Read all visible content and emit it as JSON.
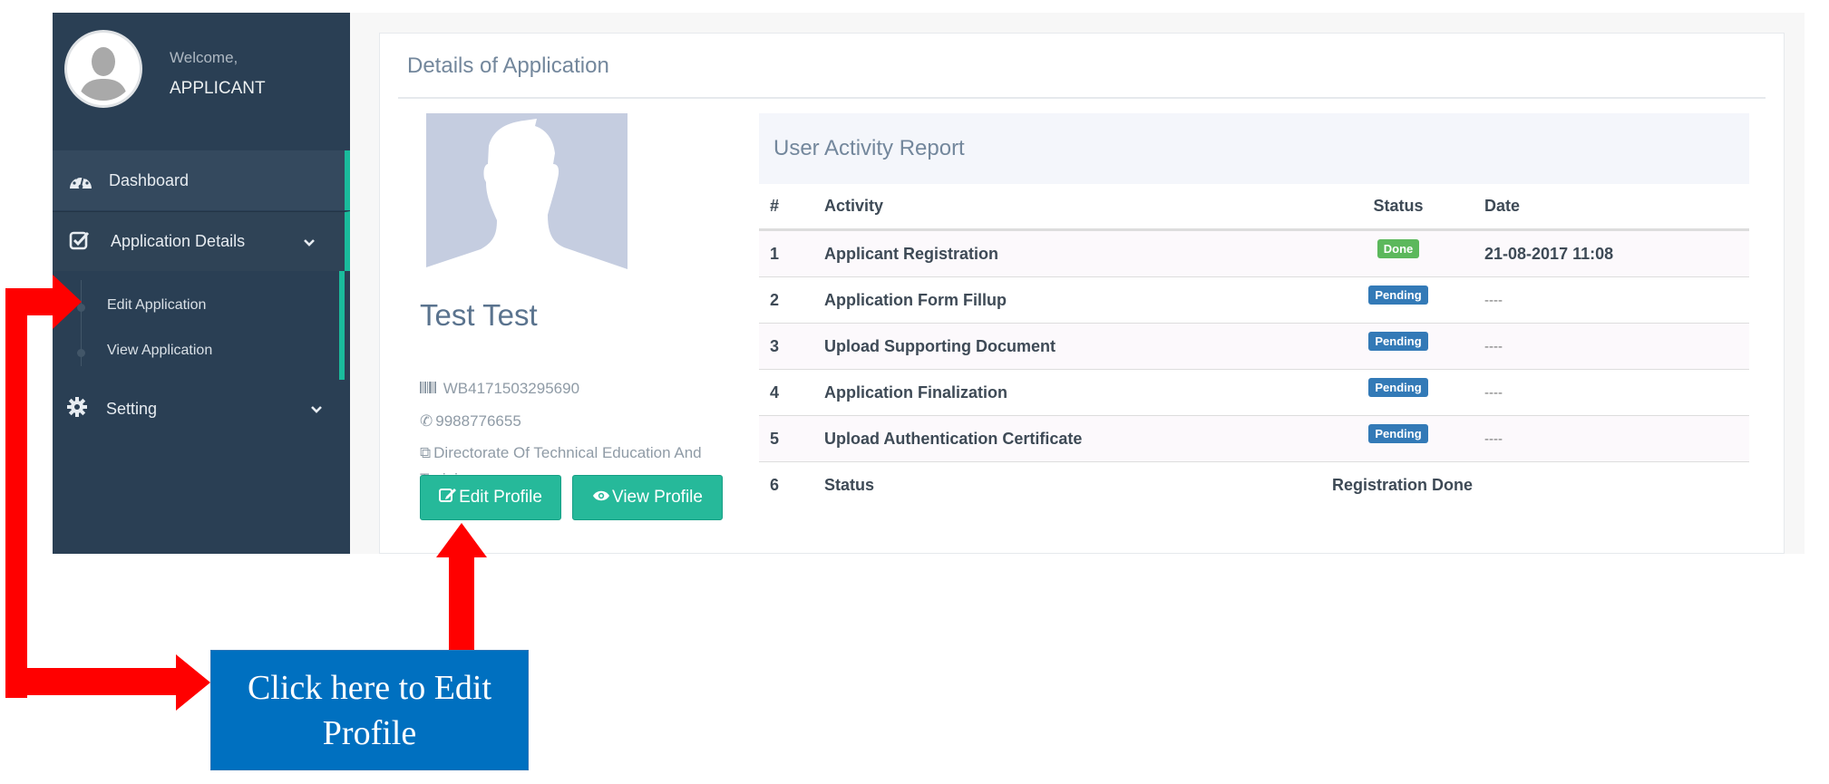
{
  "sidebar": {
    "welcome": "Welcome,",
    "username": "APPLICANT",
    "items": [
      {
        "label": "Dashboard",
        "icon": "dashboard-icon"
      },
      {
        "label": "Application Details",
        "icon": "check-square-icon",
        "expanded": true,
        "children": [
          {
            "label": "Edit Application"
          },
          {
            "label": "View Application"
          }
        ]
      },
      {
        "label": "Setting",
        "icon": "gear-icon",
        "expanded": false
      }
    ]
  },
  "main": {
    "title": "Details of Application",
    "profile": {
      "name": "Test Test",
      "application_id": "WB4171503295690",
      "phone": "9988776655",
      "institute": "Directorate Of Technical Education And Training",
      "edit_button": "Edit Profile",
      "view_button": "View Profile"
    },
    "report": {
      "title": "User Activity Report",
      "columns": [
        "#",
        "Activity",
        "Status",
        "Date"
      ],
      "rows": [
        {
          "num": "1",
          "activity": "Applicant Registration",
          "status": "Done",
          "date": "21-08-2017 11:08"
        },
        {
          "num": "2",
          "activity": "Application Form Fillup",
          "status": "Pending",
          "date": "----"
        },
        {
          "num": "3",
          "activity": "Upload Supporting Document",
          "status": "Pending",
          "date": "----"
        },
        {
          "num": "4",
          "activity": "Application Finalization",
          "status": "Pending",
          "date": "----"
        },
        {
          "num": "5",
          "activity": "Upload Authentication Certificate",
          "status": "Pending",
          "date": "----"
        }
      ],
      "summary": {
        "num": "6",
        "label": "Status",
        "value": "Registration Done"
      }
    }
  },
  "annotation": {
    "text": "Click here to Edit Profile",
    "arrow_color": "#ff0000",
    "box_color": "#0070c0"
  },
  "colors": {
    "sidebar_bg": "#2a3f54",
    "accent": "#1abb9c",
    "button": "#26b99a",
    "done": "#5cb85c",
    "pending": "#337ab7"
  }
}
